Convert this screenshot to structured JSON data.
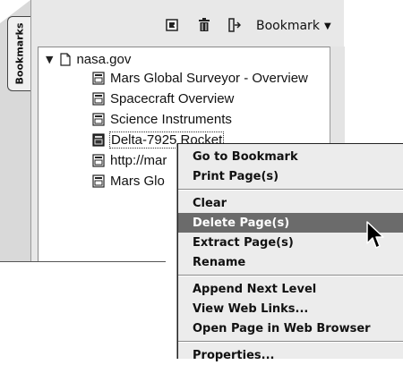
{
  "panel": {
    "tab_label": "Bookmarks",
    "toolbar": {
      "icons": [
        "new-bookmark-icon",
        "delete-icon",
        "expand-icon"
      ],
      "menu_label": "Bookmark",
      "menu_caret": "▼"
    }
  },
  "tree": {
    "root": {
      "label": "nasa.gov",
      "expanded": true,
      "toggle": "▼"
    },
    "items": [
      {
        "label": "Mars Global Surveyor - Overview"
      },
      {
        "label": "Spacecraft Overview"
      },
      {
        "label": "Science Instruments"
      },
      {
        "label": "Delta-7925 Rocket",
        "selected": true
      },
      {
        "label": "http://mar"
      },
      {
        "label": "Mars Glo"
      }
    ]
  },
  "context_menu": {
    "groups": [
      [
        "Go to Bookmark",
        "Print Page(s)"
      ],
      [
        "Clear",
        "Delete Page(s)",
        "Extract Page(s)",
        "Rename"
      ],
      [
        "Append Next Level",
        "View Web Links...",
        "Open Page in Web Browser"
      ],
      [
        "Properties..."
      ]
    ],
    "highlighted": "Delete Page(s)"
  },
  "colors": {
    "panel_bg": "#e8e8e8",
    "menu_bg": "#ececec",
    "menu_highlight": "#6b6b6b"
  }
}
